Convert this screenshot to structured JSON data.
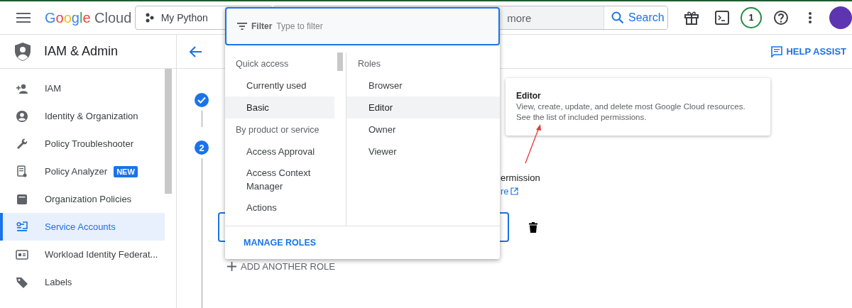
{
  "header": {
    "logo": {
      "brand": "Google",
      "product": "Cloud"
    },
    "project": "My Python",
    "search_placeholder": "more",
    "search_button": "Search",
    "notifications": "1"
  },
  "sidebar": {
    "title": "IAM & Admin",
    "items": [
      {
        "label": "IAM",
        "selected": false
      },
      {
        "label": "Identity & Organization",
        "selected": false
      },
      {
        "label": "Policy Troubleshooter",
        "selected": false
      },
      {
        "label": "Policy Analyzer",
        "selected": false,
        "badge": "NEW"
      },
      {
        "label": "Organization Policies",
        "selected": false
      },
      {
        "label": "Service Accounts",
        "selected": true
      },
      {
        "label": "Workload Identity Federat...",
        "selected": false
      },
      {
        "label": "Labels",
        "selected": false
      }
    ]
  },
  "page": {
    "help": "HELP ASSIST",
    "steps": [
      {
        "kind": "done"
      },
      {
        "kind": "number",
        "number": "2"
      }
    ],
    "description_lines": [
      {
        "kind": "text",
        "text": "ermission"
      },
      {
        "kind": "link",
        "text": "re"
      }
    ],
    "add_role": "ADD ANOTHER ROLE"
  },
  "dropdown": {
    "filter_label": "Filter",
    "filter_placeholder": "Type to filter",
    "groups": [
      {
        "heading": "Quick access",
        "items": [
          {
            "label": "Currently used",
            "selected": false
          },
          {
            "label": "Basic",
            "selected": true
          }
        ]
      },
      {
        "heading": "By product or service",
        "items": [
          {
            "label": "Access Approval",
            "selected": false
          },
          {
            "label": "Access Context Manager",
            "selected": false
          },
          {
            "label": "Actions",
            "selected": false
          }
        ]
      }
    ],
    "roles_heading": "Roles",
    "roles": [
      {
        "label": "Browser",
        "selected": false
      },
      {
        "label": "Editor",
        "selected": true
      },
      {
        "label": "Owner",
        "selected": false
      },
      {
        "label": "Viewer",
        "selected": false
      }
    ],
    "manage_button": "MANAGE ROLES"
  },
  "tooltip": {
    "title": "Editor",
    "description": "View, create, update, and delete most Google Cloud resources. See the list of included permissions."
  }
}
